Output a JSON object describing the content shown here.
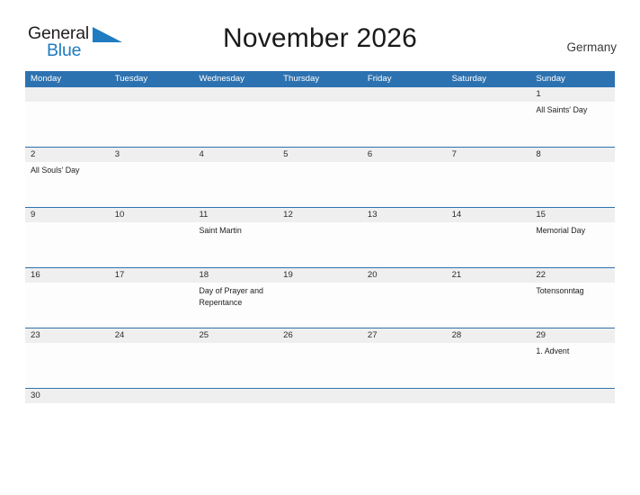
{
  "brand": {
    "name_part1": "General",
    "name_part2": "Blue",
    "flag_icon": "blue-flag-triangle"
  },
  "header": {
    "title": "November 2026",
    "country": "Germany"
  },
  "calendar": {
    "weekdays": [
      "Monday",
      "Tuesday",
      "Wednesday",
      "Thursday",
      "Friday",
      "Saturday",
      "Sunday"
    ],
    "colors": {
      "header_blue": "#2d72b0",
      "daynum_band": "#efefef",
      "brand_blue": "#1f7cc0",
      "text_dark": "#1f1f1f"
    },
    "weeks": [
      {
        "days": [
          {
            "num": "",
            "event": ""
          },
          {
            "num": "",
            "event": ""
          },
          {
            "num": "",
            "event": ""
          },
          {
            "num": "",
            "event": ""
          },
          {
            "num": "",
            "event": ""
          },
          {
            "num": "",
            "event": ""
          },
          {
            "num": "1",
            "event": "All Saints' Day"
          }
        ]
      },
      {
        "days": [
          {
            "num": "2",
            "event": "All Souls' Day"
          },
          {
            "num": "3",
            "event": ""
          },
          {
            "num": "4",
            "event": ""
          },
          {
            "num": "5",
            "event": ""
          },
          {
            "num": "6",
            "event": ""
          },
          {
            "num": "7",
            "event": ""
          },
          {
            "num": "8",
            "event": ""
          }
        ]
      },
      {
        "days": [
          {
            "num": "9",
            "event": ""
          },
          {
            "num": "10",
            "event": ""
          },
          {
            "num": "11",
            "event": "Saint Martin"
          },
          {
            "num": "12",
            "event": ""
          },
          {
            "num": "13",
            "event": ""
          },
          {
            "num": "14",
            "event": ""
          },
          {
            "num": "15",
            "event": "Memorial Day"
          }
        ]
      },
      {
        "days": [
          {
            "num": "16",
            "event": ""
          },
          {
            "num": "17",
            "event": ""
          },
          {
            "num": "18",
            "event": "Day of Prayer and Repentance"
          },
          {
            "num": "19",
            "event": ""
          },
          {
            "num": "20",
            "event": ""
          },
          {
            "num": "21",
            "event": ""
          },
          {
            "num": "22",
            "event": "Totensonntag"
          }
        ]
      },
      {
        "days": [
          {
            "num": "23",
            "event": ""
          },
          {
            "num": "24",
            "event": ""
          },
          {
            "num": "25",
            "event": ""
          },
          {
            "num": "26",
            "event": ""
          },
          {
            "num": "27",
            "event": ""
          },
          {
            "num": "28",
            "event": ""
          },
          {
            "num": "29",
            "event": "1. Advent"
          }
        ]
      },
      {
        "days": [
          {
            "num": "30",
            "event": ""
          },
          {
            "num": "",
            "event": ""
          },
          {
            "num": "",
            "event": ""
          },
          {
            "num": "",
            "event": ""
          },
          {
            "num": "",
            "event": ""
          },
          {
            "num": "",
            "event": ""
          },
          {
            "num": "",
            "event": ""
          }
        ]
      }
    ]
  }
}
